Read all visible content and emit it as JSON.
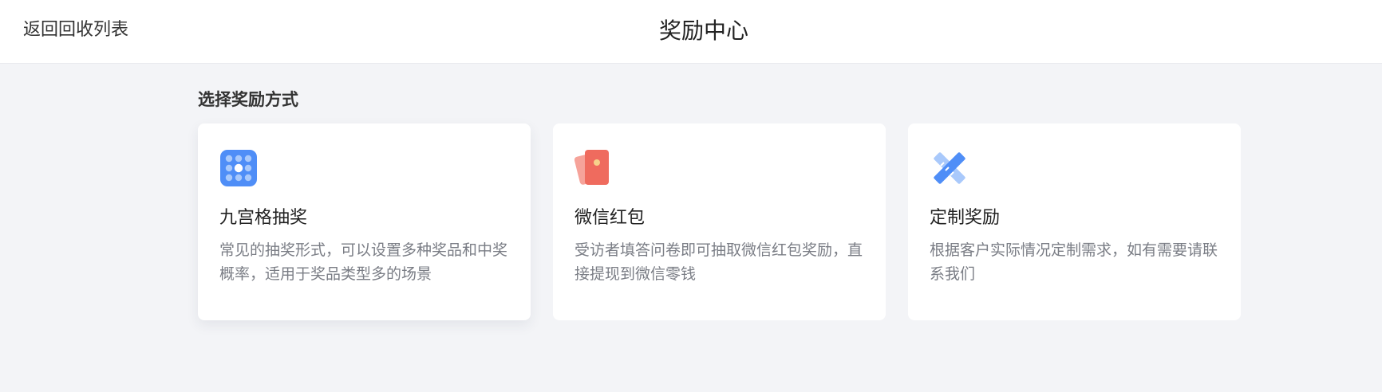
{
  "header": {
    "back_label": "返回回收列表",
    "title": "奖励中心"
  },
  "main": {
    "section_title": "选择奖励方式",
    "cards": [
      {
        "icon": "grid-lottery-icon",
        "title": "九宫格抽奖",
        "description": "常见的抽奖形式，可以设置多种奖品和中奖概率，适用于奖品类型多的场景"
      },
      {
        "icon": "red-envelope-icon",
        "title": "微信红包",
        "description": "受访者填答问卷即可抽取微信红包奖励，直接提现到微信零钱"
      },
      {
        "icon": "ruler-pencil-icon",
        "title": "定制奖励",
        "description": "根据客户实际情况定制需求，如有需要请联系我们"
      }
    ]
  },
  "colors": {
    "page_background": "#f3f4f7",
    "card_background": "#ffffff",
    "accent_blue": "#4f8ef7",
    "red_envelope": "#ef6b5e"
  }
}
